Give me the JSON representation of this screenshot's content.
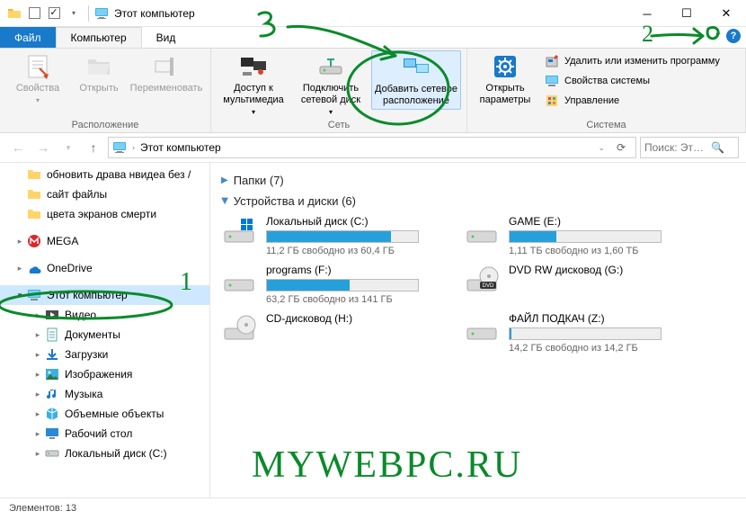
{
  "window": {
    "title": "Этот компьютер"
  },
  "tabs": {
    "file": "Файл",
    "computer": "Компьютер",
    "view": "Вид"
  },
  "ribbon": {
    "location": {
      "label": "Расположение",
      "properties": "Свойства",
      "open": "Открыть",
      "rename": "Переименовать"
    },
    "network": {
      "label": "Сеть",
      "media": "Доступ к мультимедиа",
      "mapDrive": "Подключить сетевой диск",
      "addLocation": "Добавить сетевое расположение"
    },
    "system": {
      "label": "Система",
      "settings": "Открыть параметры",
      "uninstall": "Удалить или изменить программу",
      "sysprops": "Свойства системы",
      "manage": "Управление"
    }
  },
  "address": {
    "location": "Этот компьютер",
    "searchPlaceholder": "Поиск: Эт…"
  },
  "tree": {
    "items": [
      {
        "label": "обновить драва нвидеа без /",
        "icon": "folder"
      },
      {
        "label": "сайт файлы",
        "icon": "folder"
      },
      {
        "label": "цвета экранов смерти",
        "icon": "folder"
      },
      {
        "label": "MEGA",
        "icon": "mega",
        "expandable": true
      },
      {
        "label": "OneDrive",
        "icon": "onedrive",
        "expandable": true
      },
      {
        "label": "Этот компьютер",
        "icon": "pc",
        "expandable": true,
        "open": true,
        "selected": true
      },
      {
        "label": "Видео",
        "icon": "video",
        "depth": 2,
        "expandable": true
      },
      {
        "label": "Документы",
        "icon": "documents",
        "depth": 2,
        "expandable": true
      },
      {
        "label": "Загрузки",
        "icon": "downloads",
        "depth": 2,
        "expandable": true
      },
      {
        "label": "Изображения",
        "icon": "pictures",
        "depth": 2,
        "expandable": true
      },
      {
        "label": "Музыка",
        "icon": "music",
        "depth": 2,
        "expandable": true
      },
      {
        "label": "Объемные объекты",
        "icon": "3d",
        "depth": 2,
        "expandable": true
      },
      {
        "label": "Рабочий стол",
        "icon": "desktop",
        "depth": 2,
        "expandable": true
      },
      {
        "label": "Локальный диск (C:)",
        "icon": "drive",
        "depth": 2,
        "expandable": true
      }
    ]
  },
  "content": {
    "foldersHeader": "Папки (7)",
    "devicesHeader": "Устройства и диски (6)",
    "devices": [
      {
        "name": "Локальный диск (C:)",
        "sub": "11,2 ГБ свободно из 60,4 ГБ",
        "fill": 82,
        "type": "os"
      },
      {
        "name": "GAME (E:)",
        "sub": "1,11 ТБ свободно из 1,60 ТБ",
        "fill": 31,
        "type": "hdd"
      },
      {
        "name": "programs (F:)",
        "sub": "63,2 ГБ свободно из 141 ГБ",
        "fill": 55,
        "type": "hdd"
      },
      {
        "name": "DVD RW дисковод (G:)",
        "sub": "",
        "fill": null,
        "type": "dvd"
      },
      {
        "name": "CD-дисковод (H:)",
        "sub": "",
        "fill": null,
        "type": "cd"
      },
      {
        "name": "ФАЙЛ ПОДКАЧ (Z:)",
        "sub": "14,2 ГБ свободно из 14,2 ГБ",
        "fill": 1,
        "type": "hdd"
      }
    ]
  },
  "status": {
    "text": "Элементов: 13"
  },
  "annotations": {
    "n1": "1",
    "n2": "2",
    "n3": "3",
    "watermark": "MYWEBPC.RU"
  }
}
